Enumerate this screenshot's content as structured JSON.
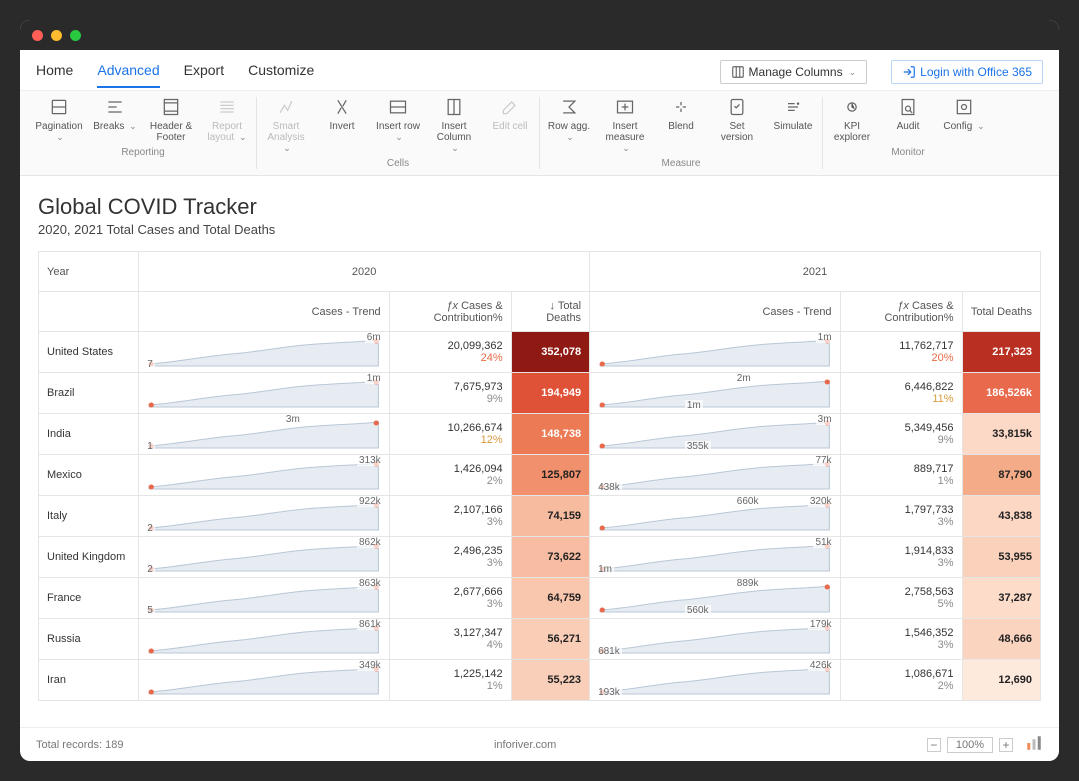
{
  "titlebar_colors": {
    "red": "#ff5f57",
    "yellow": "#febc2e",
    "green": "#28c840"
  },
  "tabs": [
    "Home",
    "Advanced",
    "Export",
    "Customize"
  ],
  "active_tab": 1,
  "manage_columns": "Manage Columns",
  "login": "Login with Office 365",
  "ribbon": {
    "groups": [
      {
        "label": "Reporting",
        "items": [
          {
            "label": "Pagination",
            "icon": "pagination-icon",
            "chev": true
          },
          {
            "label": "Breaks",
            "icon": "breaks-icon",
            "chev": true
          },
          {
            "label": "Header & Footer",
            "icon": "header-footer-icon"
          },
          {
            "label": "Report layout",
            "icon": "report-layout-icon",
            "chev": true,
            "dis": true
          }
        ]
      },
      {
        "label": "Cells",
        "items": [
          {
            "label": "Smart Analysis",
            "icon": "smart-analysis-icon",
            "chev": true,
            "dis": true
          },
          {
            "label": "Invert",
            "icon": "invert-icon"
          },
          {
            "label": "Insert row",
            "icon": "insert-row-icon",
            "chev": true
          },
          {
            "label": "Insert Column",
            "icon": "insert-column-icon",
            "chev": true
          },
          {
            "label": "Edit cell",
            "icon": "edit-cell-icon",
            "dis": true
          }
        ]
      },
      {
        "label": "Measure",
        "items": [
          {
            "label": "Row agg.",
            "icon": "row-agg-icon",
            "chev": true
          },
          {
            "label": "Insert measure",
            "icon": "insert-measure-icon",
            "chev": true
          },
          {
            "label": "Blend",
            "icon": "blend-icon"
          },
          {
            "label": "Set version",
            "icon": "set-version-icon"
          },
          {
            "label": "Simulate",
            "icon": "simulate-icon"
          }
        ]
      },
      {
        "label": "Monitor",
        "items": [
          {
            "label": "KPI explorer",
            "icon": "kpi-explorer-icon"
          },
          {
            "label": "Audit",
            "icon": "audit-icon"
          },
          {
            "label": "Config",
            "icon": "config-icon",
            "chev": true
          }
        ]
      }
    ]
  },
  "title": "Global COVID Tracker",
  "subtitle": "2020, 2021 Total Cases and Total Deaths",
  "year_header": "Year",
  "years": [
    "2020",
    "2021"
  ],
  "column_headers": {
    "trend": "Cases - Trend",
    "cases": "Cases & Contribution%",
    "cases_prefix": "ƒx",
    "deaths": "Total Deaths",
    "deaths_prefix": "↓"
  },
  "pct_colors": {
    "red": "#e86b45",
    "orange": "#d99a3a",
    "gray": "#8a8a8a"
  },
  "rows": [
    {
      "name": "United States",
      "y2020": {
        "trend_start": "7",
        "trend_end": "6m",
        "cases": "20,099,362",
        "pct": "24%",
        "pct_c": "red",
        "deaths": "352,078",
        "bg": "#8f1a13",
        "fg": "#fff"
      },
      "y2021": {
        "trend_end": "1m",
        "cases": "11,762,717",
        "pct": "20%",
        "pct_c": "red",
        "deaths": "217,323",
        "bg": "#b93022",
        "fg": "#fff"
      }
    },
    {
      "name": "Brazil",
      "y2020": {
        "trend_end": "1m",
        "cases": "7,675,973",
        "pct": "9%",
        "pct_c": "gray",
        "deaths": "194,949",
        "bg": "#e05238",
        "fg": "#fff"
      },
      "y2021": {
        "trend_mid1": "1m",
        "trend_mid2": "2m",
        "cases": "6,446,822",
        "pct": "11%",
        "pct_c": "orange",
        "deaths": "186,526k",
        "bg": "#e8694b",
        "fg": "#fff"
      }
    },
    {
      "name": "India",
      "y2020": {
        "trend_start": "1",
        "trend_mid2": "3m",
        "cases": "10,266,674",
        "pct": "12%",
        "pct_c": "orange",
        "deaths": "148,738",
        "bg": "#ec7a55",
        "fg": "#fff"
      },
      "y2021": {
        "trend_mid1": "355k",
        "trend_end": "3m",
        "cases": "5,349,456",
        "pct": "9%",
        "pct_c": "gray",
        "deaths": "33,815k",
        "bg": "#fcd9c6"
      }
    },
    {
      "name": "Mexico",
      "y2020": {
        "trend_end": "313k",
        "cases": "1,426,094",
        "pct": "2%",
        "pct_c": "gray",
        "deaths": "125,807",
        "bg": "#f0906d"
      },
      "y2021": {
        "trend_start": "438k",
        "trend_end": "77k",
        "cases": "889,717",
        "pct": "1%",
        "pct_c": "gray",
        "deaths": "87,790",
        "bg": "#f4ab87"
      }
    },
    {
      "name": "Italy",
      "y2020": {
        "trend_start": "2",
        "trend_end": "922k",
        "cases": "2,107,166",
        "pct": "3%",
        "pct_c": "gray",
        "deaths": "74,159",
        "bg": "#f7bb9f"
      },
      "y2021": {
        "trend_mid2": "660k",
        "trend_end": "320k",
        "cases": "1,797,733",
        "pct": "3%",
        "pct_c": "gray",
        "deaths": "43,838",
        "bg": "#fcd7c4"
      }
    },
    {
      "name": "United Kingdom",
      "y2020": {
        "trend_start": "2",
        "trend_end": "862k",
        "cases": "2,496,235",
        "pct": "3%",
        "pct_c": "gray",
        "deaths": "73,622",
        "bg": "#f7bca1"
      },
      "y2021": {
        "trend_start": "1m",
        "trend_end": "51k",
        "cases": "1,914,833",
        "pct": "3%",
        "pct_c": "gray",
        "deaths": "53,955",
        "bg": "#fad1bb"
      }
    },
    {
      "name": "France",
      "y2020": {
        "trend_start": "5",
        "trend_end": "863k",
        "cases": "2,677,666",
        "pct": "3%",
        "pct_c": "gray",
        "deaths": "64,759",
        "bg": "#f9c6ae"
      },
      "y2021": {
        "trend_mid1": "560k",
        "trend_mid2": "889k",
        "cases": "2,758,563",
        "pct": "5%",
        "pct_c": "gray",
        "deaths": "37,287",
        "bg": "#fddcca"
      }
    },
    {
      "name": "Russia",
      "y2020": {
        "trend_end": "861k",
        "cases": "3,127,347",
        "pct": "4%",
        "pct_c": "gray",
        "deaths": "56,271",
        "bg": "#facdb7"
      },
      "y2021": {
        "trend_start": "681k",
        "trend_end": "179k",
        "cases": "1,546,352",
        "pct": "3%",
        "pct_c": "gray",
        "deaths": "48,666",
        "bg": "#fbd4c0"
      }
    },
    {
      "name": "Iran",
      "y2020": {
        "trend_end": "349k",
        "cases": "1,225,142",
        "pct": "1%",
        "pct_c": "gray",
        "deaths": "55,223",
        "bg": "#facfba"
      },
      "y2021": {
        "trend_start": "193k",
        "trend_end": "426k",
        "cases": "1,086,671",
        "pct": "2%",
        "pct_c": "gray",
        "deaths": "12,690",
        "bg": "#feeadd"
      }
    }
  ],
  "footer": {
    "records": "Total records: 189",
    "site": "inforiver.com",
    "zoom": "100%"
  },
  "chart_data": {
    "type": "table",
    "title": "Global COVID Tracker — 2020, 2021 Total Cases and Total Deaths",
    "series": [
      {
        "name": "2020 Cases",
        "values": [
          20099362,
          7675973,
          10266674,
          1426094,
          2107166,
          2496235,
          2677666,
          3127347,
          1225142
        ]
      },
      {
        "name": "2020 Contribution%",
        "values": [
          24,
          9,
          12,
          2,
          3,
          3,
          3,
          4,
          1
        ]
      },
      {
        "name": "2020 Total Deaths",
        "values": [
          352078,
          194949,
          148738,
          125807,
          74159,
          73622,
          64759,
          56271,
          55223
        ]
      },
      {
        "name": "2021 Cases",
        "values": [
          11762717,
          6446822,
          5349456,
          889717,
          1797733,
          1914833,
          2758563,
          1546352,
          1086671
        ]
      },
      {
        "name": "2021 Contribution%",
        "values": [
          20,
          11,
          9,
          1,
          3,
          3,
          5,
          3,
          2
        ]
      },
      {
        "name": "2021 Total Deaths",
        "values": [
          217323,
          186526,
          33815,
          87790,
          43838,
          53955,
          37287,
          48666,
          12690
        ]
      }
    ],
    "categories": [
      "United States",
      "Brazil",
      "India",
      "Mexico",
      "Italy",
      "United Kingdom",
      "France",
      "Russia",
      "Iran"
    ]
  }
}
